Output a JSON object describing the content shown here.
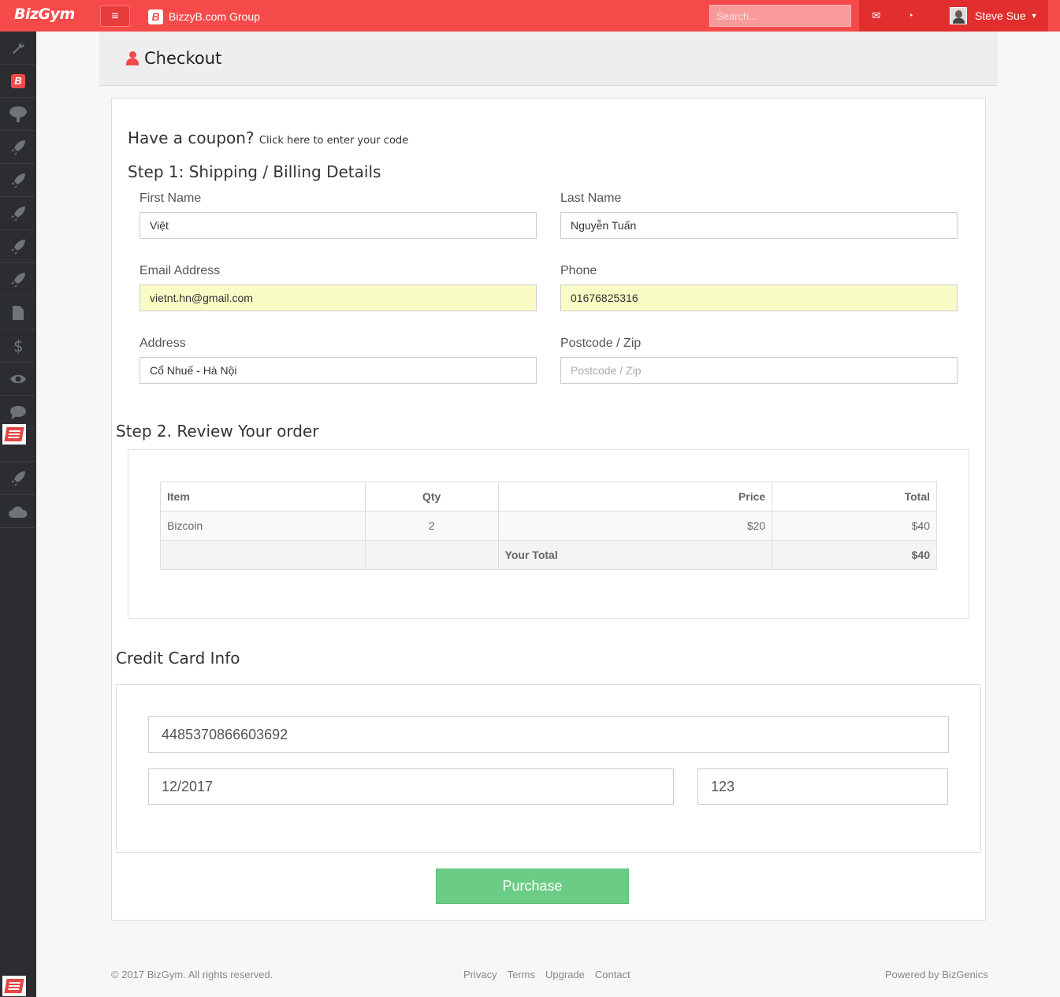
{
  "topbar": {
    "logo": "BizGym",
    "company_badge": "B",
    "company_name": "BizzyB.com Group",
    "search_placeholder": "Search...",
    "user_name": "Steve Sue",
    "menu_glyph": "≡",
    "mail_glyph": "✉",
    "rss_glyph": "◔",
    "caret_glyph": "▼"
  },
  "sidebar": {
    "icons": [
      "wrench-icon",
      "bizzy-b-icon",
      "tree-icon",
      "rocket-icon",
      "rocket-icon",
      "rocket-icon",
      "rocket-icon",
      "rocket-icon",
      "file-icon",
      "dollar-icon",
      "eye-icon",
      "chat-icon",
      "app-image-icon",
      "rocket-icon",
      "cloud-icon"
    ],
    "badge": "B"
  },
  "page": {
    "title": "Checkout"
  },
  "coupon": {
    "heading": "Have a coupon?",
    "link": "Click here to enter your code"
  },
  "step1": {
    "heading": "Step 1: Shipping / Billing Details",
    "fields": {
      "first_name": {
        "label": "First Name",
        "value": "Việt"
      },
      "last_name": {
        "label": "Last Name",
        "value": "Nguyễn Tuấn"
      },
      "email": {
        "label": "Email Address",
        "value": "vietnt.hn@gmail.com"
      },
      "phone": {
        "label": "Phone",
        "value": "01676825316"
      },
      "address": {
        "label": "Address",
        "value": "Cổ Nhuế - Hà Nội"
      },
      "postcode": {
        "label": "Postcode / Zip",
        "value": "",
        "placeholder": "Postcode / Zip"
      }
    }
  },
  "step2": {
    "heading": "Step 2. Review Your order",
    "columns": [
      "Item",
      "Qty",
      "Price",
      "Total"
    ],
    "rows": [
      {
        "item": "Bizcoin",
        "qty": "2",
        "price": "$20",
        "total": "$40"
      }
    ],
    "total_label": "Your Total",
    "total_value": "$40"
  },
  "credit_card": {
    "heading": "Credit Card Info",
    "number": "4485370866603692",
    "expiry": "12/2017",
    "cvv": "123"
  },
  "purchase_label": "Purchase",
  "footer": {
    "copyright": "© 2017 BizGym. All rights reserved.",
    "links": [
      "Privacy",
      "Terms",
      "Upgrade",
      "Contact"
    ],
    "powered": "Powered by BizGenics"
  },
  "colors": {
    "brand_red": "#f64a4a",
    "dark_red": "#e22e2e",
    "sidebar": "#2b2d31",
    "purchase_green": "#6bcc85",
    "autofill_yellow": "#fafcc6"
  }
}
